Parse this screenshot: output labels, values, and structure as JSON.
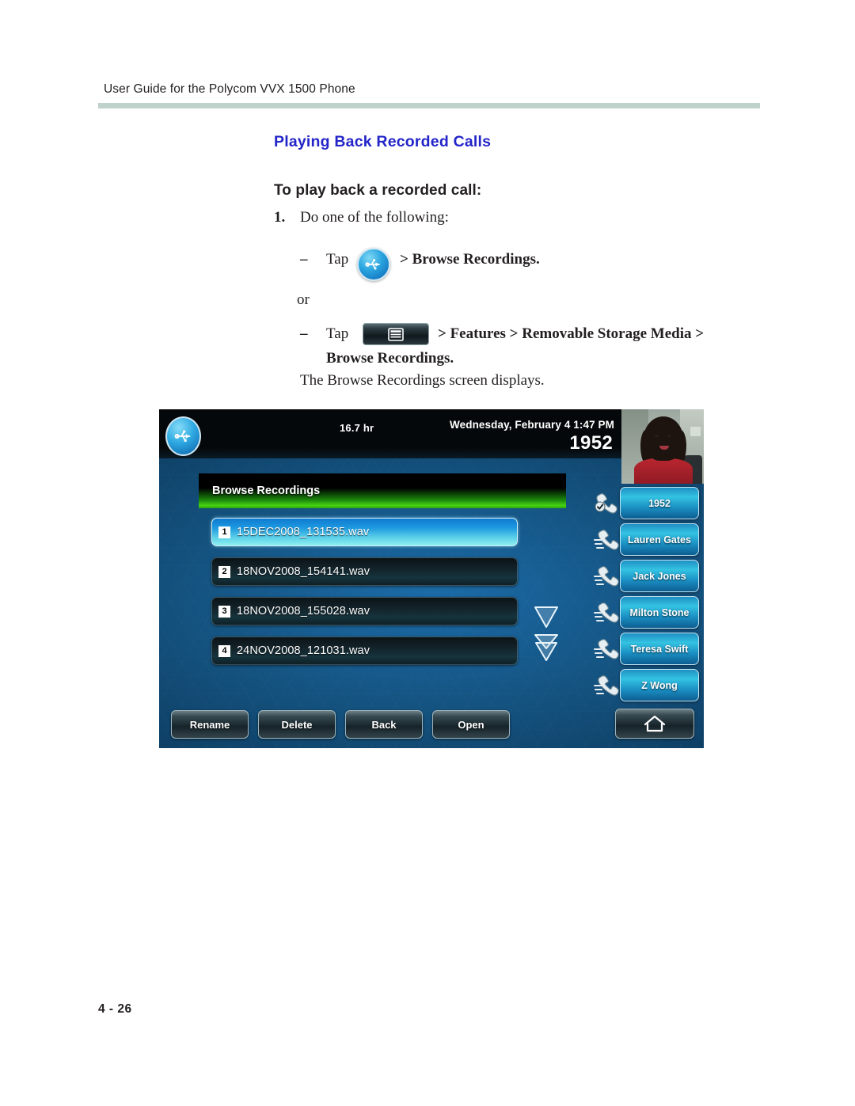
{
  "header": {
    "running_head": "User Guide for the Polycom VVX 1500 Phone"
  },
  "document": {
    "section_title": "Playing Back Recorded Calls",
    "procedure_title": "To play back a recorded call:",
    "step_number": "1.",
    "step_text": "Do one of the following:",
    "bullet_dash": "–",
    "bullet1": {
      "tap_label": "Tap",
      "icon": "usb-icon",
      "trailing": "> Browse Recordings."
    },
    "or_label": "or",
    "bullet2": {
      "tap_label": "Tap",
      "icon": "menu-icon",
      "trailing_line1": "> Features > Removable Storage Media >",
      "trailing_line2": "Browse Recordings."
    },
    "result_text": "The Browse Recordings screen displays."
  },
  "phone": {
    "statusbar": {
      "usb_icon": "usb-icon",
      "storage_hours": "16.7 hr",
      "datetime": "Wednesday, February 4  1:47 PM",
      "extension": "1952"
    },
    "video": {
      "label": "video-thumbnail"
    },
    "list_title": "Browse Recordings",
    "recordings": [
      {
        "index": "1",
        "name": "15DEC2008_131535.wav",
        "selected": true
      },
      {
        "index": "2",
        "name": "18NOV2008_154141.wav",
        "selected": false
      },
      {
        "index": "3",
        "name": "18NOV2008_155028.wav",
        "selected": false
      },
      {
        "index": "4",
        "name": "24NOV2008_121031.wav",
        "selected": false
      }
    ],
    "scroll": {
      "down_icon": "chevron-down-icon",
      "page_down_icon": "double-chevron-down-icon"
    },
    "line_keys": [
      {
        "label": "1952",
        "icon": "handset-registered-icon"
      },
      {
        "label": "Lauren Gates",
        "icon": "handset-icon"
      },
      {
        "label": "Jack Jones",
        "icon": "handset-icon"
      },
      {
        "label": "Milton Stone",
        "icon": "handset-icon"
      },
      {
        "label": "Teresa Swift",
        "icon": "handset-icon"
      },
      {
        "label": "Z Wong",
        "icon": "handset-icon"
      }
    ],
    "soft_keys": [
      {
        "label": "Rename"
      },
      {
        "label": "Delete"
      },
      {
        "label": "Back"
      },
      {
        "label": "Open"
      }
    ],
    "home_key": {
      "icon": "home-icon"
    }
  },
  "footer": {
    "page_number": "4 - 26"
  },
  "colors": {
    "section_title": "#2325C9",
    "rule": "#BED1CB",
    "title_bar_green": "#2EA30C",
    "selected_row_start": "#0F7AD0",
    "selected_row_end": "#8FF0EF",
    "line_key": "#34C3E2",
    "body_text": "#231F20"
  }
}
